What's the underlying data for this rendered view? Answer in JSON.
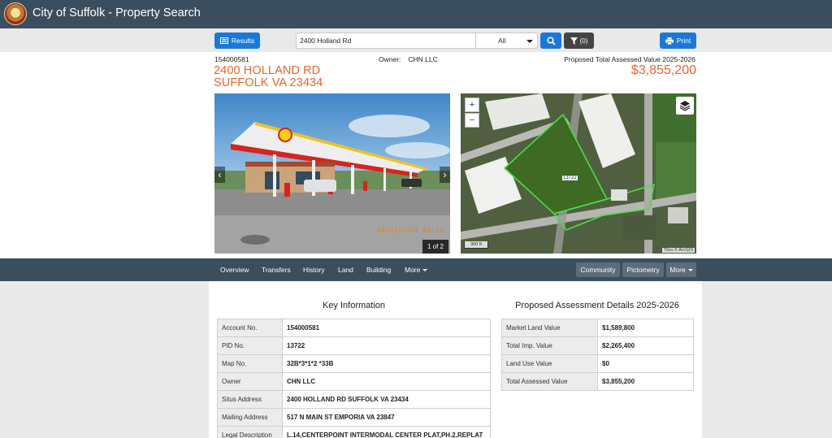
{
  "app": {
    "title": "City of Suffolk - Property Search",
    "logo": "city-seal"
  },
  "toolbar": {
    "results_label": "Results",
    "search_value": "2400 Holland Rd",
    "scope_selected": "All",
    "filter_label": "(0)",
    "print_label": "Print"
  },
  "property": {
    "account_no": "154000581",
    "owner_label": "Owner:",
    "owner": "CHN LLC",
    "address_line1": "2400 HOLLAND RD",
    "address_line2": "SUFFOLK VA 23434",
    "assessed_label": "Proposed Total Assessed Value 2025-2026",
    "assessed_value": "$3,855,200",
    "photo_counter": "1 of 2",
    "photo_timestamp": "09/01/2024 09:31",
    "map_parcel_label": "13722",
    "map_scale": "300 ft",
    "map_attribution": "Tiles © ArcGIS"
  },
  "nav": {
    "tabs": [
      "Overview",
      "Transfers",
      "History",
      "Land",
      "Building",
      "More"
    ],
    "right_buttons": [
      "Community",
      "Pictometry",
      "More"
    ]
  },
  "key_info": {
    "title": "Key Information",
    "rows": [
      {
        "label": "Account No.",
        "value": "154000581"
      },
      {
        "label": "PID No.",
        "value": "13722"
      },
      {
        "label": "Map No.",
        "value": "32B*3*1*2 *33B"
      },
      {
        "label": "Owner",
        "value": "CHN LLC"
      },
      {
        "label": "Situs Address",
        "value": "2400 HOLLAND RD SUFFOLK VA 23434"
      },
      {
        "label": "Mailing Address",
        "value": "517 N MAIN ST EMPORIA VA 23847"
      },
      {
        "label": "Legal Description",
        "value": "L.14,CENTERPOINT INTERMODAL CENTER PLAT,PH.2,REPLAT"
      }
    ]
  },
  "assessment": {
    "title": "Proposed Assessment Details 2025-2026",
    "rows": [
      {
        "label": "Market Land Value",
        "value": "$1,589,800"
      },
      {
        "label": "Total Imp. Value",
        "value": "$2,265,400"
      },
      {
        "label": "Land Use Value",
        "value": "$0"
      },
      {
        "label": "Total Assessed Value",
        "value": "$3,855,200"
      }
    ]
  },
  "colors": {
    "header": "#3b4e5d",
    "accent": "#1a79d8",
    "address": "#e8642c"
  }
}
